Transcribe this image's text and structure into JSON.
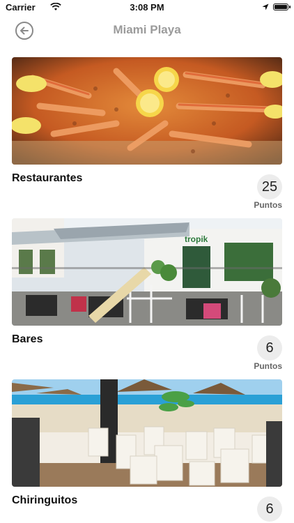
{
  "status": {
    "carrier": "Carrier",
    "time": "3:08 PM"
  },
  "nav": {
    "title": "Miami Playa",
    "back_icon": "arrow-left-icon"
  },
  "categories": [
    {
      "label": "Restaurantes",
      "count": "25",
      "units": "Puntos",
      "image": "paella-photo"
    },
    {
      "label": "Bares",
      "count": "6",
      "units": "Puntos",
      "image": "bar-terrace-photo"
    },
    {
      "label": "Chiringuitos",
      "count": "6",
      "units": "",
      "image": "beach-bar-photo"
    }
  ],
  "colors": {
    "background": "#ffffff",
    "title": "#9b9b9b",
    "badge": "#ececec"
  }
}
